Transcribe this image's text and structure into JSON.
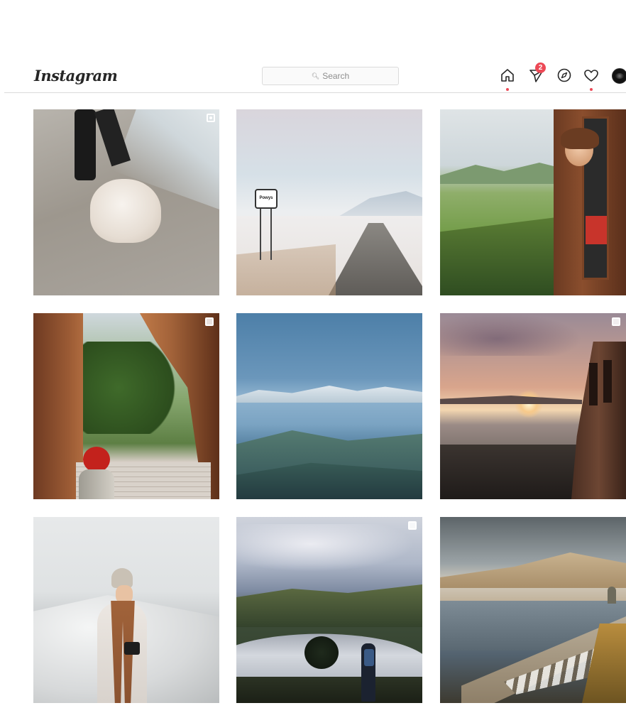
{
  "header": {
    "logo": "Instagram",
    "search_placeholder": "Search",
    "direct_badge": "2"
  },
  "icons": {
    "home": "home-icon",
    "direct": "paper-plane-icon",
    "explore": "compass-icon",
    "activity": "heart-icon",
    "profile": "avatar"
  },
  "colors": {
    "accent": "#ed4956",
    "border": "#dbdbdb",
    "text": "#262626",
    "muted": "#8e8e8e"
  },
  "grid": {
    "columns": 3,
    "rows": 3,
    "posts": [
      {
        "subject": "dog on beach",
        "badge": "video-icon"
      },
      {
        "subject": "snowy road with sign",
        "badge": ""
      },
      {
        "subject": "woman leaning out of train window",
        "badge": ""
      },
      {
        "subject": "child looking out of tent",
        "badge": "carousel-icon"
      },
      {
        "subject": "blue mountain landscape",
        "badge": ""
      },
      {
        "subject": "sunset over pier",
        "badge": "carousel-icon"
      },
      {
        "subject": "woman in snow with scarf",
        "badge": ""
      },
      {
        "subject": "hiker at lake",
        "badge": "carousel-icon"
      },
      {
        "subject": "dam over reservoir",
        "badge": ""
      }
    ]
  },
  "sign_text": "Powys"
}
